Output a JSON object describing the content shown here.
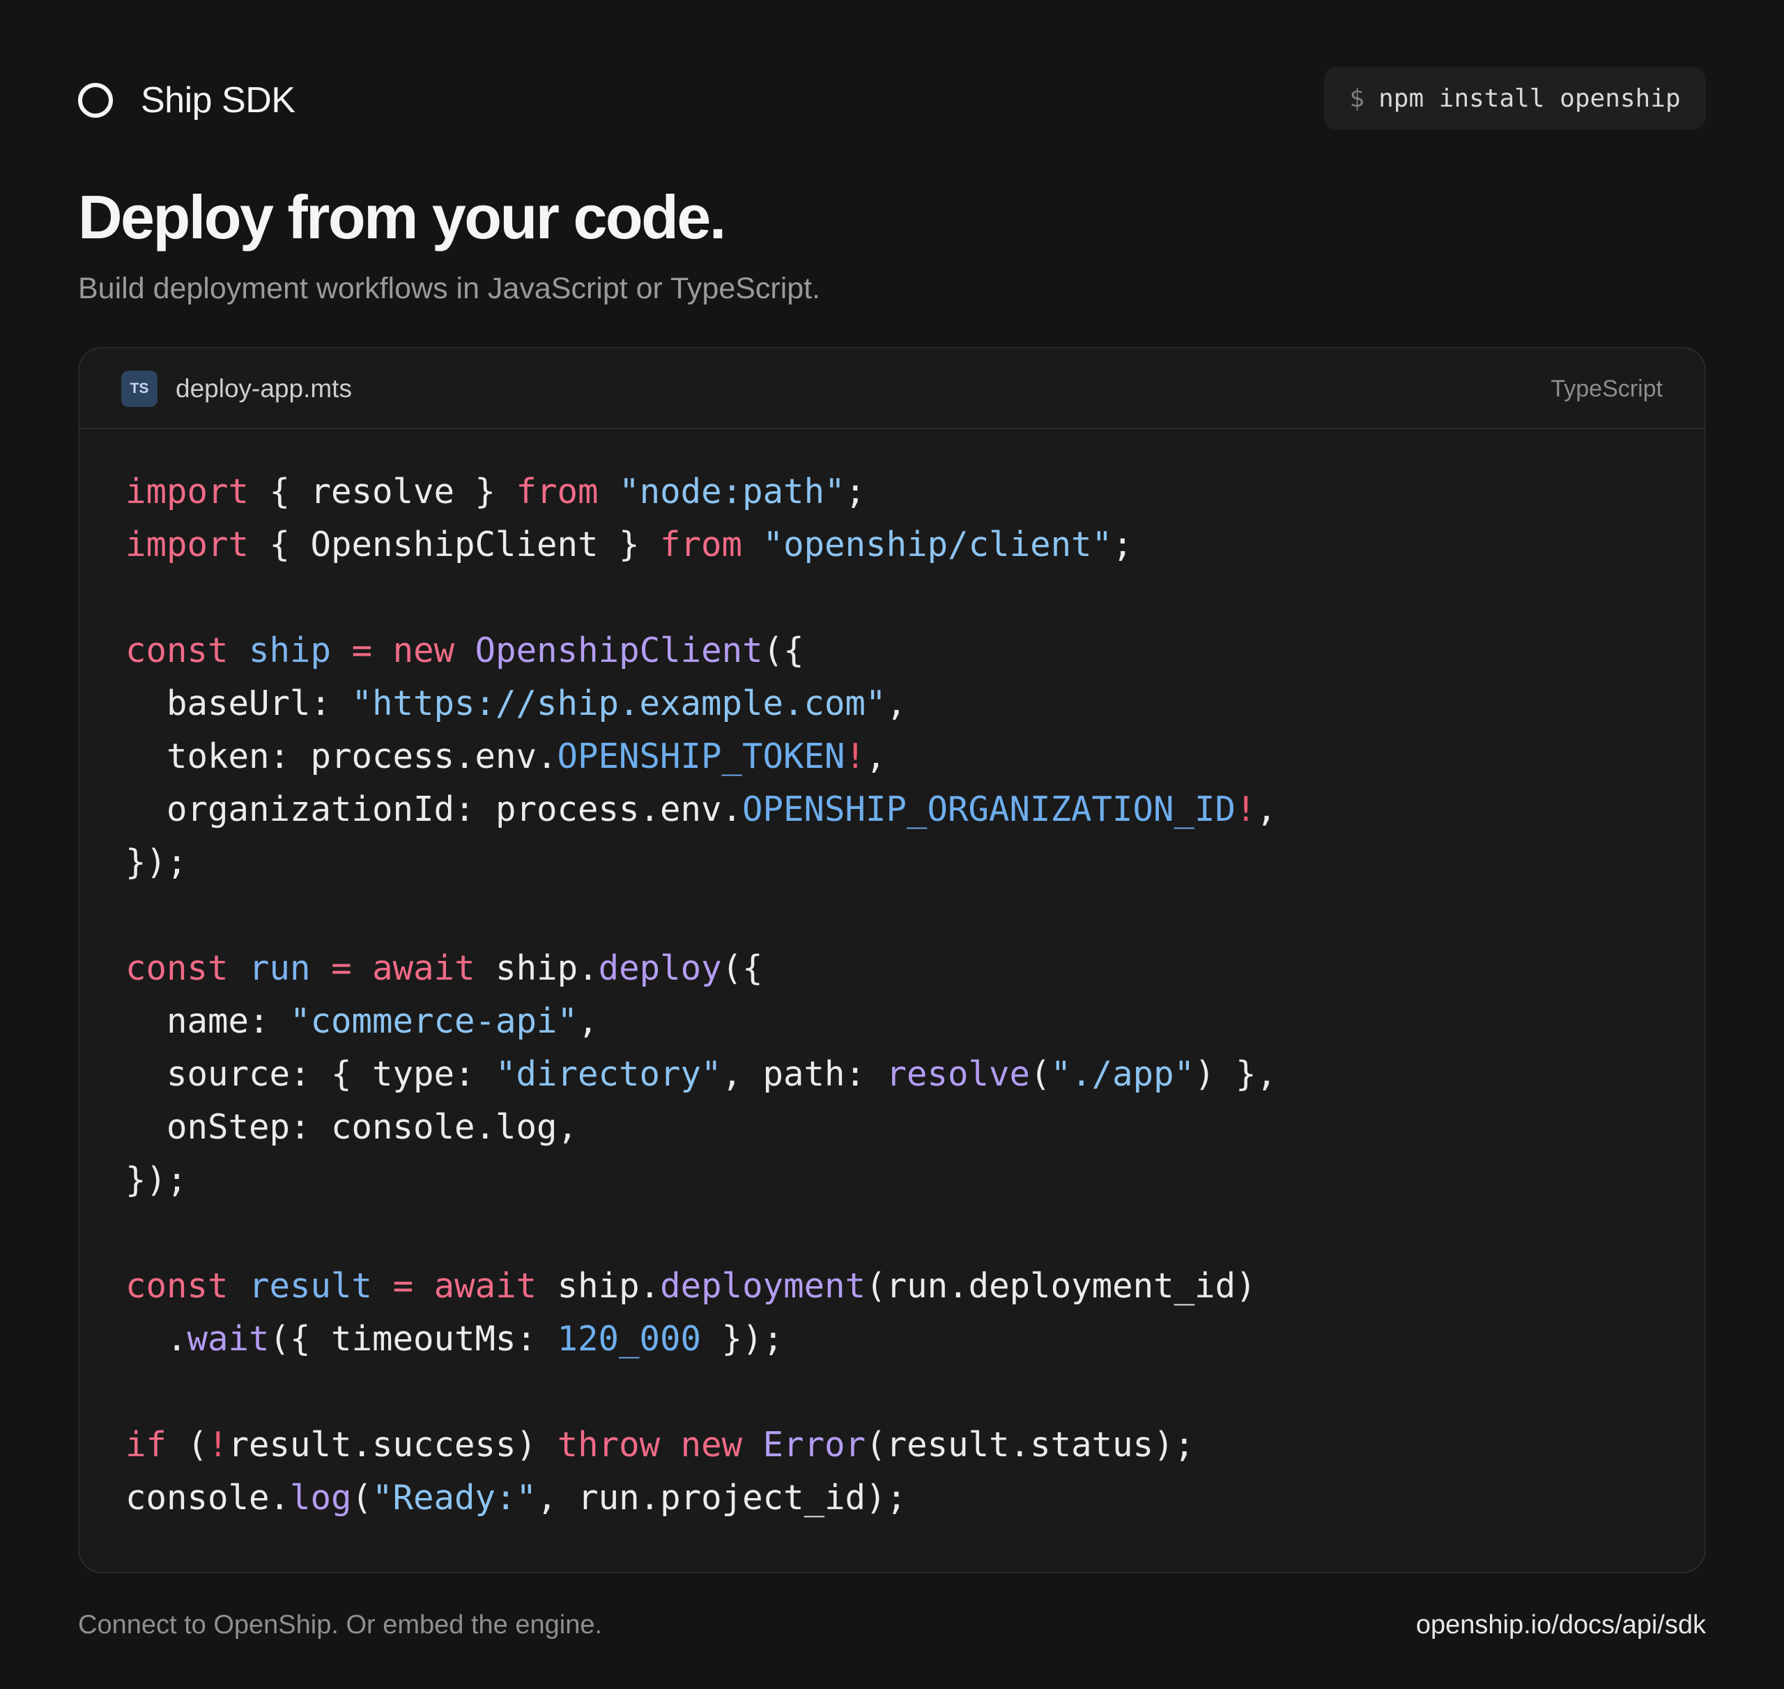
{
  "header": {
    "brand_name": "Ship SDK",
    "brand_icon": "ring-logo-icon",
    "install_prompt": "$",
    "install_command": "npm install openship"
  },
  "hero": {
    "title": "Deploy from your code.",
    "subtitle": "Build deployment workflows in JavaScript or TypeScript."
  },
  "code_card": {
    "badge": "TS",
    "filename": "deploy-app.mts",
    "language": "TypeScript",
    "lines": [
      [
        [
          "kw",
          "import"
        ],
        [
          "p",
          " { resolve } "
        ],
        [
          "kw",
          "from"
        ],
        [
          "p",
          " "
        ],
        [
          "str",
          "\"node:path\""
        ],
        [
          "p",
          ";"
        ]
      ],
      [
        [
          "kw",
          "import"
        ],
        [
          "p",
          " { OpenshipClient } "
        ],
        [
          "kw",
          "from"
        ],
        [
          "p",
          " "
        ],
        [
          "str",
          "\"openship/client\""
        ],
        [
          "p",
          ";"
        ]
      ],
      [],
      [
        [
          "kw",
          "const"
        ],
        [
          "p",
          " "
        ],
        [
          "var",
          "ship"
        ],
        [
          "p",
          " "
        ],
        [
          "kw",
          "="
        ],
        [
          "p",
          " "
        ],
        [
          "kw",
          "new"
        ],
        [
          "p",
          " "
        ],
        [
          "fn",
          "OpenshipClient"
        ],
        [
          "p",
          "({"
        ]
      ],
      [
        [
          "p",
          "  baseUrl: "
        ],
        [
          "str",
          "\"https://ship.example.com\""
        ],
        [
          "p",
          ","
        ]
      ],
      [
        [
          "p",
          "  token: process.env."
        ],
        [
          "const",
          "OPENSHIP_TOKEN"
        ],
        [
          "bang",
          "!"
        ],
        [
          "p",
          ","
        ]
      ],
      [
        [
          "p",
          "  organizationId: process.env."
        ],
        [
          "const",
          "OPENSHIP_ORGANIZATION_ID"
        ],
        [
          "bang",
          "!"
        ],
        [
          "p",
          ","
        ]
      ],
      [
        [
          "p",
          "});"
        ]
      ],
      [],
      [
        [
          "kw",
          "const"
        ],
        [
          "p",
          " "
        ],
        [
          "var",
          "run"
        ],
        [
          "p",
          " "
        ],
        [
          "kw",
          "="
        ],
        [
          "p",
          " "
        ],
        [
          "kw",
          "await"
        ],
        [
          "p",
          " ship."
        ],
        [
          "fn",
          "deploy"
        ],
        [
          "p",
          "({"
        ]
      ],
      [
        [
          "p",
          "  name: "
        ],
        [
          "str",
          "\"commerce-api\""
        ],
        [
          "p",
          ","
        ]
      ],
      [
        [
          "p",
          "  source: { type: "
        ],
        [
          "str",
          "\"directory\""
        ],
        [
          "p",
          ", path: "
        ],
        [
          "fn",
          "resolve"
        ],
        [
          "p",
          "("
        ],
        [
          "str",
          "\"./app\""
        ],
        [
          "p",
          ") },"
        ]
      ],
      [
        [
          "p",
          "  onStep: console.log,"
        ]
      ],
      [
        [
          "p",
          "});"
        ]
      ],
      [],
      [
        [
          "kw",
          "const"
        ],
        [
          "p",
          " "
        ],
        [
          "var",
          "result"
        ],
        [
          "p",
          " "
        ],
        [
          "kw",
          "="
        ],
        [
          "p",
          " "
        ],
        [
          "kw",
          "await"
        ],
        [
          "p",
          " ship."
        ],
        [
          "fn",
          "deployment"
        ],
        [
          "p",
          "(run.deployment_id)"
        ]
      ],
      [
        [
          "p",
          "  ."
        ],
        [
          "fn",
          "wait"
        ],
        [
          "p",
          "({ timeoutMs: "
        ],
        [
          "num",
          "120_000"
        ],
        [
          "p",
          " });"
        ]
      ],
      [],
      [
        [
          "kw",
          "if"
        ],
        [
          "p",
          " ("
        ],
        [
          "bang",
          "!"
        ],
        [
          "p",
          "result.success) "
        ],
        [
          "kw",
          "throw"
        ],
        [
          "p",
          " "
        ],
        [
          "kw",
          "new"
        ],
        [
          "p",
          " "
        ],
        [
          "fn",
          "Error"
        ],
        [
          "p",
          "(result.status);"
        ]
      ],
      [
        [
          "p",
          "console."
        ],
        [
          "fn",
          "log"
        ],
        [
          "p",
          "("
        ],
        [
          "str",
          "\"Ready:\""
        ],
        [
          "p",
          ", run.project_id);"
        ]
      ]
    ]
  },
  "footer": {
    "tagline": "Connect to OpenShip. Or embed the engine.",
    "link": "openship.io/docs/api/sdk"
  },
  "colors": {
    "background": "#141414",
    "card": "#1a1a1a",
    "keyword": "#f06b87",
    "string": "#8cc4f2",
    "function": "#b39df2",
    "identifier": "#7db4f0"
  }
}
